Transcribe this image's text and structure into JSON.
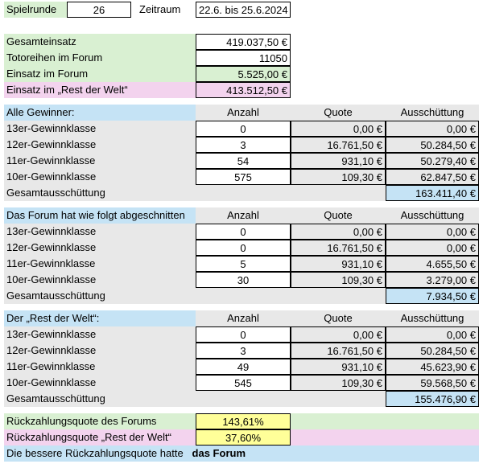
{
  "header": {
    "spielrunde_label": "Spielrunde",
    "spielrunde_value": "26",
    "zeitraum_label": "Zeitraum",
    "zeitraum_value": "22.6. bis 25.6.2024"
  },
  "summary": {
    "gesamteinsatz_label": "Gesamteinsatz",
    "gesamteinsatz_value": "419.037,50 €",
    "totoreihen_label": "Totoreihen im Forum",
    "totoreihen_value": "11050",
    "einsatz_forum_label": "Einsatz im Forum",
    "einsatz_forum_value": "5.525,00 €",
    "einsatz_rest_label": "Einsatz im „Rest der Welt“",
    "einsatz_rest_value": "413.512,50 €"
  },
  "columns": {
    "anzahl": "Anzahl",
    "quote": "Quote",
    "ausschuettung": "Ausschüttung"
  },
  "sections": [
    {
      "title": "Alle Gewinner:",
      "rows": [
        {
          "label": "13er-Gewinnklasse",
          "anzahl": "0",
          "quote": "0,00 €",
          "ausschuettung": "0,00 €"
        },
        {
          "label": "12er-Gewinnklasse",
          "anzahl": "3",
          "quote": "16.761,50 €",
          "ausschuettung": "50.284,50 €"
        },
        {
          "label": "11er-Gewinnklasse",
          "anzahl": "54",
          "quote": "931,10 €",
          "ausschuettung": "50.279,40 €"
        },
        {
          "label": "10er-Gewinnklasse",
          "anzahl": "575",
          "quote": "109,30 €",
          "ausschuettung": "62.847,50 €"
        }
      ],
      "total_label": "Gesamtausschüttung",
      "total_value": "163.411,40 €"
    },
    {
      "title": "Das Forum hat wie folgt abgeschnitten",
      "rows": [
        {
          "label": "13er-Gewinnklasse",
          "anzahl": "0",
          "quote": "0,00 €",
          "ausschuettung": "0,00 €"
        },
        {
          "label": "12er-Gewinnklasse",
          "anzahl": "0",
          "quote": "16.761,50 €",
          "ausschuettung": "0,00 €"
        },
        {
          "label": "11er-Gewinnklasse",
          "anzahl": "5",
          "quote": "931,10 €",
          "ausschuettung": "4.655,50 €"
        },
        {
          "label": "10er-Gewinnklasse",
          "anzahl": "30",
          "quote": "109,30 €",
          "ausschuettung": "3.279,00 €"
        }
      ],
      "total_label": "Gesamtausschüttung",
      "total_value": "7.934,50 €"
    },
    {
      "title": "Der „Rest der Welt“:",
      "rows": [
        {
          "label": "13er-Gewinnklasse",
          "anzahl": "0",
          "quote": "0,00 €",
          "ausschuettung": "0,00 €"
        },
        {
          "label": "12er-Gewinnklasse",
          "anzahl": "3",
          "quote": "16.761,50 €",
          "ausschuettung": "50.284,50 €"
        },
        {
          "label": "11er-Gewinnklasse",
          "anzahl": "49",
          "quote": "931,10 €",
          "ausschuettung": "45.623,90 €"
        },
        {
          "label": "10er-Gewinnklasse",
          "anzahl": "545",
          "quote": "109,30 €",
          "ausschuettung": "59.568,50 €"
        }
      ],
      "total_label": "Gesamtausschüttung",
      "total_value": "155.476,90 €"
    }
  ],
  "result": {
    "forum_label": "Rückzahlungsquote des Forums",
    "forum_value": "143,61%",
    "rest_label": "Rückzahlungsquote „Rest der Welt“",
    "rest_value": "37,60%",
    "better_label": "Die bessere Rückzahlungsquote hatte",
    "better_value": "das Forum"
  }
}
